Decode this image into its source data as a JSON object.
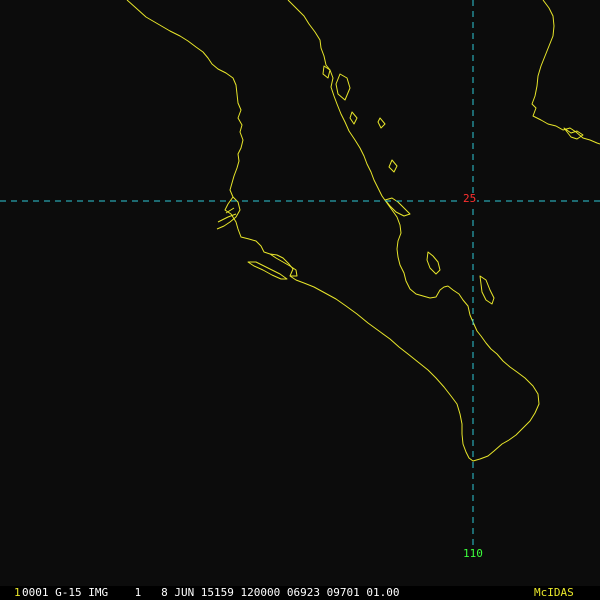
{
  "map": {
    "latitude_label": "25",
    "longitude_label": "110"
  },
  "status_bar": {
    "frame_number": "1",
    "info": "0001 G-15 IMG    1   8 JUN 15159 120000 06923 09701 01.00",
    "software": "McIDAS"
  },
  "colors": {
    "background": "#0c0c0c",
    "coastline": "#e8e62a",
    "gridline": "#2ec8d6",
    "latitude_label": "#ff3030",
    "longitude_label": "#3cff3c",
    "frame_number": "#e8e62a",
    "status_text": "#ffffff",
    "software_label": "#e8e62a"
  }
}
